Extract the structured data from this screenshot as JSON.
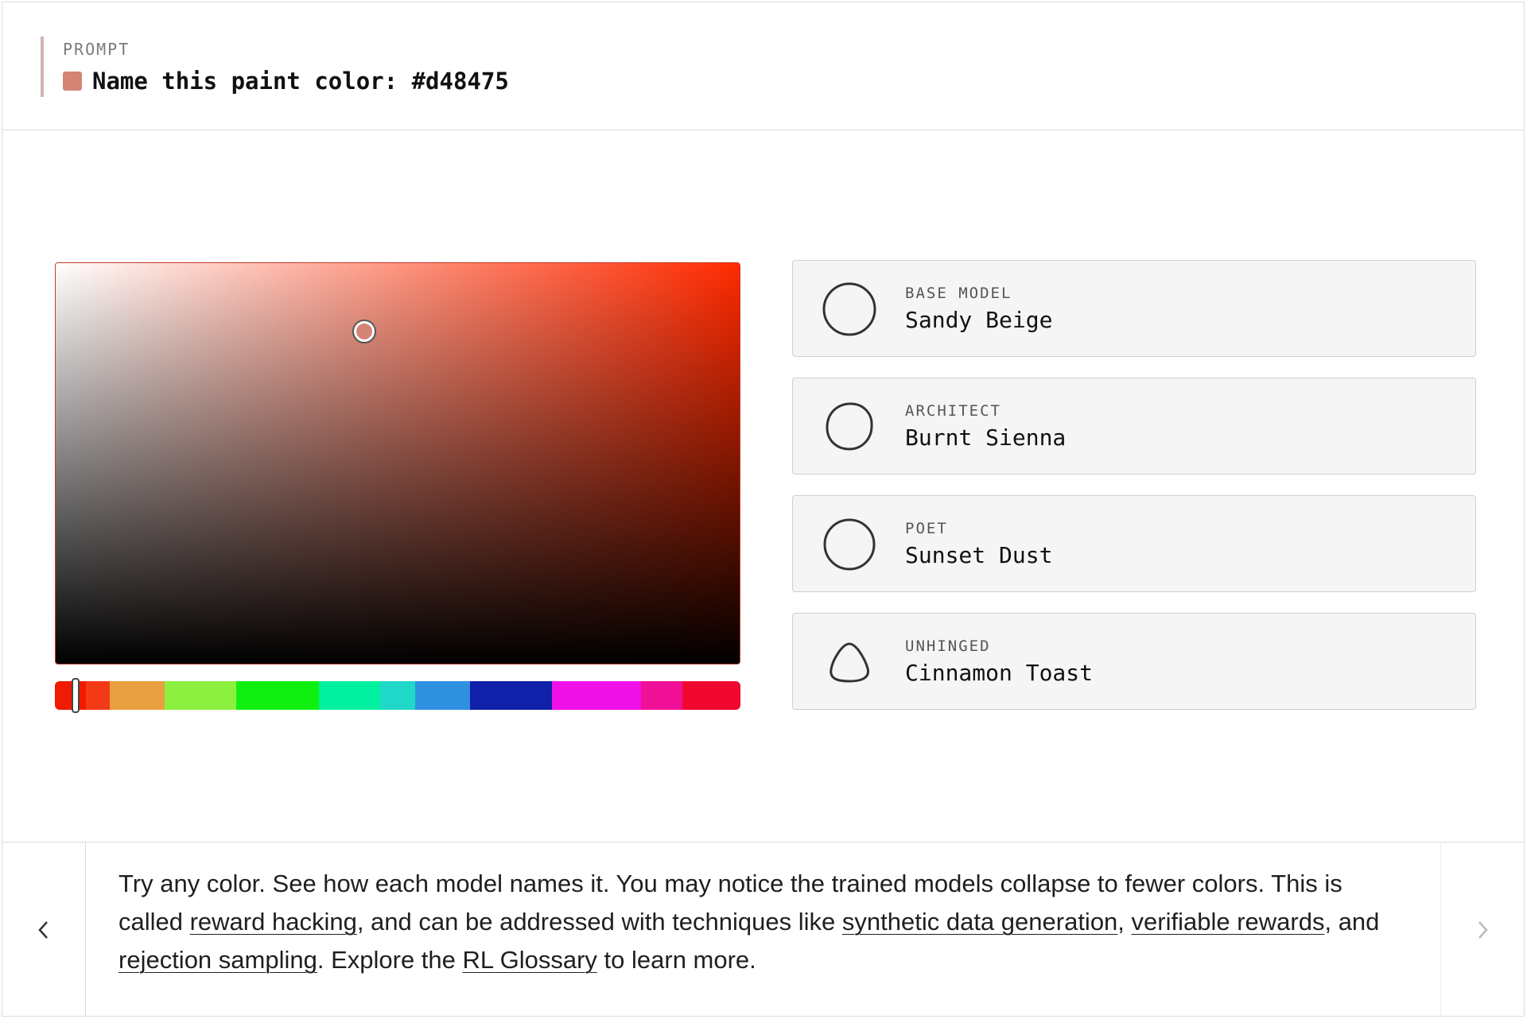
{
  "prompt": {
    "label": "PROMPT",
    "text": "Name this paint color: #d48475",
    "swatch_color": "#d48475"
  },
  "picker": {
    "hue_color": "#ff2a00",
    "selected_color": "#d48475",
    "saturation": 0.45,
    "brightness": 0.83,
    "hue_position": 0.02,
    "hue_segments": [
      "#f21a00",
      "#f53a18",
      "#e8a040",
      "#8cf040",
      "#10f010",
      "#00f0a0",
      "#20d8c8",
      "#3090e0",
      "#1020a8",
      "#f010e8",
      "#f01098",
      "#f00830"
    ]
  },
  "cards": [
    {
      "label": "BASE MODEL",
      "name": "Sandy Beige",
      "icon": "circle-icon"
    },
    {
      "label": "ARCHITECT",
      "name": "Burnt Sienna",
      "icon": "wobbly-circle-icon"
    },
    {
      "label": "POET",
      "name": "Sunset Dust",
      "icon": "circle-icon"
    },
    {
      "label": "UNHINGED",
      "name": "Cinnamon Toast",
      "icon": "blob-triangle-icon"
    }
  ],
  "footer": {
    "t1": "Try any color. See how each model names it. You may notice the trained models collapse to fewer colors. This is called ",
    "link1": "reward hacking",
    "t2": ", and can be addressed with techniques like ",
    "link2": "synthetic data generation",
    "t3": ", ",
    "link3": "verifiable rewards",
    "t4": ", and ",
    "link4": "rejection sampling",
    "t5": ". Explore the ",
    "link5": "RL Glossary",
    "t6": " to learn more.",
    "prev_icon": "chevron-left-icon",
    "next_icon": "chevron-right-icon"
  }
}
